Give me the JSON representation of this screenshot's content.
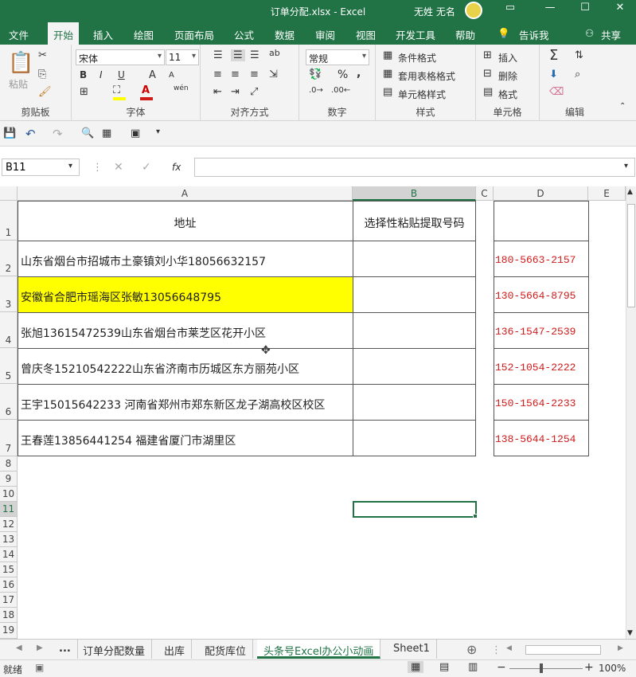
{
  "titlebar": {
    "filename": "订单分配.xlsx",
    "sep": "-",
    "app": "Excel",
    "user": "无姓 无名",
    "ribbon_icon": "▭",
    "min": "—",
    "max": "☐",
    "close": "✕"
  },
  "ribbon_tabs": [
    "文件",
    "开始",
    "插入",
    "绘图",
    "页面布局",
    "公式",
    "数据",
    "审阅",
    "视图",
    "开发工具",
    "帮助"
  ],
  "tell_me": "告诉我",
  "share": "共享",
  "clipboard": {
    "paste": "粘贴",
    "label": "剪贴板"
  },
  "font": {
    "name": "宋体",
    "size": "11",
    "bold": "B",
    "italic": "I",
    "underline": "U",
    "grow": "A",
    "shrink": "A",
    "wen": "wén",
    "label": "字体"
  },
  "align": {
    "label": "对齐方式"
  },
  "number": {
    "format": "常规",
    "percent": "%",
    "comma": ",",
    "label": "数字"
  },
  "styles": {
    "cond": "条件格式",
    "table": "套用表格格式",
    "cell": "单元格样式",
    "label": "样式"
  },
  "cells": {
    "insert": "插入",
    "delete": "删除",
    "format": "格式",
    "label": "单元格"
  },
  "editing": {
    "sum": "Σ",
    "label": "编辑"
  },
  "namebox": "B11",
  "fx": "fx",
  "formula": "",
  "columns": [
    "A",
    "B",
    "C",
    "D",
    "E"
  ],
  "rows": [
    "1",
    "2",
    "3",
    "4",
    "5",
    "6",
    "7",
    "8",
    "9",
    "10",
    "11",
    "12",
    "13",
    "14",
    "15",
    "16",
    "17",
    "18",
    "19"
  ],
  "header_a": "地址",
  "header_b": "选择性粘贴提取号码",
  "addresses": [
    "山东省烟台市招城市土豪镇刘小华18056632157",
    "安徽省合肥市瑶海区张敏13056648795",
    "张旭13615472539山东省烟台市莱芝区花开小区",
    "曾庆冬15210542222山东省济南市历城区东方丽苑小区",
    "王宇15015642233 河南省郑州市郑东新区龙子湖高校区校区",
    "王春莲13856441254 福建省厦门市湖里区"
  ],
  "phones": [
    "180-5663-2157",
    "130-5664-8795",
    "136-1547-2539",
    "152-1054-2222",
    "150-1564-2233",
    "138-5644-1254"
  ],
  "sheets": [
    "...",
    "订单分配数量",
    "出库",
    "配货库位",
    "头条号Excel办公小动画",
    "Sheet1"
  ],
  "add_sheet": "⊕",
  "status": {
    "ready": "就绪",
    "zoom": "100%",
    "minus": "−",
    "plus": "+"
  },
  "colors": {
    "accent": "#217346",
    "highlight": "#ffff00",
    "phone": "#d01b1b"
  }
}
